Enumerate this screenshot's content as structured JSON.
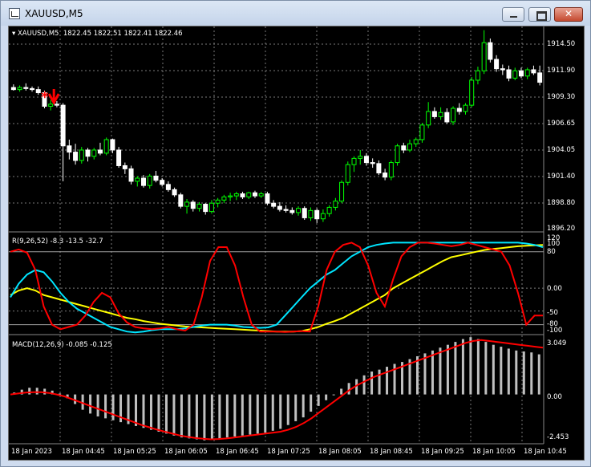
{
  "window": {
    "title": "XAUUSD,M5"
  },
  "main_pane": {
    "symbol_label": "XAUUSD,M5",
    "ohlc_label": "1822.45 1822.51 1822.41 1822.46",
    "price_ticks": [
      "1914.50",
      "1911.90",
      "1909.30",
      "1906.65",
      "1904.05",
      "1901.40",
      "1898.80",
      "1896.20"
    ]
  },
  "rsi_pane": {
    "label": "R(9,26,52) -8.3 -13.5 -32.7",
    "ticks": [
      "120",
      "100",
      "80",
      "0.00",
      "-50",
      "-80",
      "-100"
    ]
  },
  "macd_pane": {
    "label": "MACD(12,26,9) -0.085 -0.125",
    "ticks": [
      "3.049",
      "0.00",
      "-2.453"
    ]
  },
  "time_axis": [
    "18 Jan 2023",
    "18 Jan 04:45",
    "18 Jan 05:25",
    "18 Jan 06:05",
    "18 Jan 06:45",
    "18 Jan 07:25",
    "18 Jan 08:05",
    "18 Jan 08:45",
    "18 Jan 09:25",
    "18 Jan 10:05",
    "18 Jan 10:45"
  ],
  "colors": {
    "bull": "#00ff00",
    "bear": "#ffffff",
    "rsi_fast": "#ff0000",
    "rsi_mid": "#00e5ff",
    "rsi_slow": "#ffff00",
    "macd_hist": "#c0c0c0",
    "macd_signal": "#ff0000",
    "arrow": "#ff0000"
  },
  "chart_data": {
    "type": "candlestick",
    "price_range": [
      1896.2,
      1915.6
    ],
    "grid": true,
    "candles": [
      {
        "o": 1909.9,
        "h": 1910.2,
        "l": 1909.6,
        "c": 1909.7
      },
      {
        "o": 1909.7,
        "h": 1910.1,
        "l": 1909.5,
        "c": 1909.9
      },
      {
        "o": 1909.9,
        "h": 1910.3,
        "l": 1909.6,
        "c": 1909.8
      },
      {
        "o": 1909.8,
        "h": 1910.0,
        "l": 1909.5,
        "c": 1909.7
      },
      {
        "o": 1909.7,
        "h": 1910.0,
        "l": 1909.2,
        "c": 1909.4
      },
      {
        "o": 1909.4,
        "h": 1909.6,
        "l": 1907.9,
        "c": 1908.1
      },
      {
        "o": 1908.1,
        "h": 1908.7,
        "l": 1907.7,
        "c": 1908.3
      },
      {
        "o": 1908.3,
        "h": 1908.6,
        "l": 1908.0,
        "c": 1908.2
      },
      {
        "o": 1908.2,
        "h": 1908.4,
        "l": 1900.9,
        "c": 1904.3
      },
      {
        "o": 1904.3,
        "h": 1904.9,
        "l": 1903.0,
        "c": 1903.7
      },
      {
        "o": 1903.7,
        "h": 1904.5,
        "l": 1902.5,
        "c": 1902.9
      },
      {
        "o": 1902.9,
        "h": 1904.2,
        "l": 1902.6,
        "c": 1903.9
      },
      {
        "o": 1903.9,
        "h": 1904.1,
        "l": 1902.8,
        "c": 1903.3
      },
      {
        "o": 1903.3,
        "h": 1904.1,
        "l": 1903.0,
        "c": 1903.9
      },
      {
        "o": 1903.9,
        "h": 1904.6,
        "l": 1903.4,
        "c": 1903.6
      },
      {
        "o": 1903.6,
        "h": 1905.1,
        "l": 1903.4,
        "c": 1904.9
      },
      {
        "o": 1904.9,
        "h": 1905.0,
        "l": 1903.6,
        "c": 1903.9
      },
      {
        "o": 1903.9,
        "h": 1904.2,
        "l": 1902.2,
        "c": 1902.4
      },
      {
        "o": 1902.4,
        "h": 1902.7,
        "l": 1901.6,
        "c": 1902.1
      },
      {
        "o": 1902.1,
        "h": 1902.4,
        "l": 1900.6,
        "c": 1900.9
      },
      {
        "o": 1900.9,
        "h": 1901.4,
        "l": 1900.4,
        "c": 1901.2
      },
      {
        "o": 1901.2,
        "h": 1901.5,
        "l": 1900.3,
        "c": 1900.5
      },
      {
        "o": 1900.5,
        "h": 1901.6,
        "l": 1900.2,
        "c": 1901.4
      },
      {
        "o": 1901.4,
        "h": 1901.9,
        "l": 1900.8,
        "c": 1901.0
      },
      {
        "o": 1901.0,
        "h": 1901.2,
        "l": 1900.4,
        "c": 1900.6
      },
      {
        "o": 1900.6,
        "h": 1900.9,
        "l": 1899.9,
        "c": 1900.1
      },
      {
        "o": 1900.1,
        "h": 1900.3,
        "l": 1899.4,
        "c": 1899.6
      },
      {
        "o": 1899.6,
        "h": 1899.8,
        "l": 1898.3,
        "c": 1898.5
      },
      {
        "o": 1898.5,
        "h": 1899.2,
        "l": 1897.8,
        "c": 1898.9
      },
      {
        "o": 1898.9,
        "h": 1899.1,
        "l": 1898.0,
        "c": 1898.3
      },
      {
        "o": 1898.3,
        "h": 1898.9,
        "l": 1898.0,
        "c": 1898.7
      },
      {
        "o": 1898.7,
        "h": 1898.8,
        "l": 1897.7,
        "c": 1898.0
      },
      {
        "o": 1898.0,
        "h": 1899.1,
        "l": 1897.8,
        "c": 1898.8
      },
      {
        "o": 1898.8,
        "h": 1899.3,
        "l": 1898.4,
        "c": 1899.1
      },
      {
        "o": 1899.1,
        "h": 1899.6,
        "l": 1898.8,
        "c": 1899.4
      },
      {
        "o": 1899.4,
        "h": 1899.8,
        "l": 1899.0,
        "c": 1899.5
      },
      {
        "o": 1899.5,
        "h": 1899.9,
        "l": 1899.1,
        "c": 1899.7
      },
      {
        "o": 1899.7,
        "h": 1899.9,
        "l": 1899.2,
        "c": 1899.4
      },
      {
        "o": 1899.4,
        "h": 1899.9,
        "l": 1899.2,
        "c": 1899.8
      },
      {
        "o": 1899.8,
        "h": 1900.0,
        "l": 1899.3,
        "c": 1899.5
      },
      {
        "o": 1899.5,
        "h": 1899.9,
        "l": 1899.3,
        "c": 1899.7
      },
      {
        "o": 1899.7,
        "h": 1899.9,
        "l": 1898.6,
        "c": 1898.8
      },
      {
        "o": 1898.8,
        "h": 1899.1,
        "l": 1898.3,
        "c": 1898.5
      },
      {
        "o": 1898.5,
        "h": 1898.9,
        "l": 1898.0,
        "c": 1898.2
      },
      {
        "o": 1898.2,
        "h": 1898.6,
        "l": 1897.9,
        "c": 1898.1
      },
      {
        "o": 1898.1,
        "h": 1898.4,
        "l": 1897.7,
        "c": 1897.9
      },
      {
        "o": 1897.9,
        "h": 1898.5,
        "l": 1897.6,
        "c": 1898.3
      },
      {
        "o": 1898.3,
        "h": 1898.5,
        "l": 1897.2,
        "c": 1897.4
      },
      {
        "o": 1897.4,
        "h": 1898.4,
        "l": 1897.1,
        "c": 1898.1
      },
      {
        "o": 1898.1,
        "h": 1898.3,
        "l": 1896.9,
        "c": 1897.3
      },
      {
        "o": 1897.3,
        "h": 1898.2,
        "l": 1897.0,
        "c": 1897.8
      },
      {
        "o": 1897.8,
        "h": 1898.6,
        "l": 1897.5,
        "c": 1898.4
      },
      {
        "o": 1898.4,
        "h": 1899.3,
        "l": 1898.1,
        "c": 1899.0
      },
      {
        "o": 1899.0,
        "h": 1901.0,
        "l": 1898.8,
        "c": 1900.8
      },
      {
        "o": 1900.8,
        "h": 1902.8,
        "l": 1900.5,
        "c": 1902.5
      },
      {
        "o": 1902.5,
        "h": 1903.3,
        "l": 1901.8,
        "c": 1903.1
      },
      {
        "o": 1903.1,
        "h": 1903.9,
        "l": 1902.5,
        "c": 1903.3
      },
      {
        "o": 1903.3,
        "h": 1903.6,
        "l": 1902.4,
        "c": 1902.7
      },
      {
        "o": 1902.7,
        "h": 1903.1,
        "l": 1902.2,
        "c": 1902.6
      },
      {
        "o": 1902.6,
        "h": 1902.9,
        "l": 1901.5,
        "c": 1901.7
      },
      {
        "o": 1901.7,
        "h": 1902.1,
        "l": 1901.0,
        "c": 1901.3
      },
      {
        "o": 1901.3,
        "h": 1902.9,
        "l": 1901.0,
        "c": 1902.7
      },
      {
        "o": 1902.7,
        "h": 1904.5,
        "l": 1902.4,
        "c": 1904.3
      },
      {
        "o": 1904.3,
        "h": 1904.6,
        "l": 1903.6,
        "c": 1903.9
      },
      {
        "o": 1903.9,
        "h": 1904.9,
        "l": 1903.7,
        "c": 1904.5
      },
      {
        "o": 1904.5,
        "h": 1905.1,
        "l": 1904.2,
        "c": 1904.9
      },
      {
        "o": 1904.9,
        "h": 1906.5,
        "l": 1904.6,
        "c": 1906.3
      },
      {
        "o": 1906.3,
        "h": 1908.5,
        "l": 1906.0,
        "c": 1907.6
      },
      {
        "o": 1907.6,
        "h": 1908.0,
        "l": 1906.9,
        "c": 1907.1
      },
      {
        "o": 1907.1,
        "h": 1908.0,
        "l": 1906.8,
        "c": 1907.5
      },
      {
        "o": 1907.5,
        "h": 1907.9,
        "l": 1906.4,
        "c": 1906.6
      },
      {
        "o": 1906.6,
        "h": 1908.1,
        "l": 1906.3,
        "c": 1907.9
      },
      {
        "o": 1907.9,
        "h": 1908.4,
        "l": 1907.3,
        "c": 1907.6
      },
      {
        "o": 1907.6,
        "h": 1908.4,
        "l": 1907.3,
        "c": 1908.2
      },
      {
        "o": 1908.2,
        "h": 1910.9,
        "l": 1908.0,
        "c": 1910.6
      },
      {
        "o": 1910.6,
        "h": 1911.9,
        "l": 1910.2,
        "c": 1911.5
      },
      {
        "o": 1911.5,
        "h": 1915.4,
        "l": 1911.2,
        "c": 1914.2
      },
      {
        "o": 1914.2,
        "h": 1914.6,
        "l": 1912.3,
        "c": 1912.6
      },
      {
        "o": 1912.6,
        "h": 1913.0,
        "l": 1911.4,
        "c": 1911.7
      },
      {
        "o": 1911.7,
        "h": 1912.1,
        "l": 1911.1,
        "c": 1911.6
      },
      {
        "o": 1911.6,
        "h": 1912.0,
        "l": 1910.5,
        "c": 1910.8
      },
      {
        "o": 1910.8,
        "h": 1911.8,
        "l": 1910.6,
        "c": 1911.5
      },
      {
        "o": 1911.5,
        "h": 1911.8,
        "l": 1910.8,
        "c": 1911.0
      },
      {
        "o": 1911.0,
        "h": 1911.8,
        "l": 1910.7,
        "c": 1911.6
      },
      {
        "o": 1911.6,
        "h": 1912.0,
        "l": 1911.1,
        "c": 1911.3
      },
      {
        "o": 1911.3,
        "h": 1912.0,
        "l": 1910.1,
        "c": 1910.4
      }
    ],
    "rsi_range": [
      -100,
      120
    ],
    "rsi_fast": [
      80,
      85,
      78,
      40,
      -40,
      -80,
      -90,
      -85,
      -80,
      -60,
      -30,
      -10,
      -20,
      -55,
      -75,
      -85,
      -88,
      -90,
      -88,
      -85,
      -90,
      -93,
      -80,
      -20,
      60,
      90,
      90,
      50,
      -20,
      -80,
      -95,
      -95,
      -95,
      -96,
      -95,
      -94,
      -95,
      -40,
      40,
      80,
      95,
      100,
      90,
      50,
      -10,
      -40,
      20,
      70,
      90,
      100,
      100,
      98,
      95,
      92,
      95,
      100,
      95,
      90,
      85,
      80,
      50,
      -10,
      -80,
      -60,
      -60
    ],
    "rsi_mid": [
      -20,
      10,
      30,
      40,
      35,
      15,
      -10,
      -30,
      -45,
      -55,
      -65,
      -75,
      -85,
      -90,
      -95,
      -97,
      -95,
      -92,
      -90,
      -90,
      -90,
      -88,
      -85,
      -82,
      -80,
      -80,
      -80,
      -82,
      -85,
      -86,
      -87,
      -86,
      -80,
      -60,
      -40,
      -20,
      0,
      15,
      30,
      40,
      55,
      70,
      80,
      90,
      95,
      98,
      100,
      100,
      100,
      100,
      100,
      100,
      100,
      100,
      100,
      100,
      100,
      100,
      100,
      100,
      100,
      100,
      98,
      95,
      90
    ],
    "rsi_slow": [
      -15,
      -5,
      0,
      -5,
      -15,
      -20,
      -25,
      -30,
      -35,
      -40,
      -45,
      -50,
      -55,
      -60,
      -65,
      -68,
      -72,
      -75,
      -78,
      -80,
      -82,
      -84,
      -85,
      -86,
      -87,
      -88,
      -89,
      -90,
      -91,
      -92,
      -93,
      -94,
      -95,
      -95,
      -95,
      -94,
      -90,
      -85,
      -78,
      -72,
      -65,
      -55,
      -45,
      -35,
      -25,
      -15,
      0,
      10,
      20,
      30,
      40,
      50,
      60,
      68,
      72,
      76,
      80,
      84,
      86,
      88,
      90,
      92,
      93,
      94,
      95
    ],
    "macd_range": [
      -2.453,
      3.049
    ],
    "macd_hist": [
      0.1,
      0.25,
      0.35,
      0.35,
      0.3,
      0.2,
      0.05,
      -0.2,
      -0.5,
      -0.8,
      -1.0,
      -1.15,
      -1.25,
      -1.35,
      -1.45,
      -1.55,
      -1.65,
      -1.75,
      -1.85,
      -1.95,
      -2.05,
      -2.15,
      -2.25,
      -2.3,
      -2.35,
      -2.4,
      -2.35,
      -2.3,
      -2.25,
      -2.2,
      -2.15,
      -2.1,
      -2.05,
      -2.0,
      -1.9,
      -1.8,
      -1.6,
      -1.4,
      -1.2,
      -0.9,
      -0.6,
      -0.3,
      0.0,
      0.3,
      0.6,
      0.8,
      1.0,
      1.2,
      1.3,
      1.45,
      1.6,
      1.7,
      1.85,
      2.0,
      2.15,
      2.3,
      2.45,
      2.6,
      2.75,
      2.9,
      3.0,
      2.9,
      2.75,
      2.6,
      2.5,
      2.4,
      2.3,
      2.25,
      2.2,
      2.1
    ],
    "macd_signal": [
      0.0,
      0.05,
      0.1,
      0.12,
      0.12,
      0.08,
      0.0,
      -0.1,
      -0.25,
      -0.4,
      -0.55,
      -0.7,
      -0.85,
      -1.0,
      -1.15,
      -1.3,
      -1.45,
      -1.6,
      -1.72,
      -1.84,
      -1.95,
      -2.05,
      -2.15,
      -2.22,
      -2.28,
      -2.32,
      -2.35,
      -2.33,
      -2.3,
      -2.25,
      -2.2,
      -2.15,
      -2.1,
      -2.05,
      -2.0,
      -1.95,
      -1.85,
      -1.7,
      -1.5,
      -1.25,
      -0.95,
      -0.65,
      -0.35,
      -0.05,
      0.25,
      0.5,
      0.7,
      0.9,
      1.05,
      1.2,
      1.35,
      1.5,
      1.65,
      1.8,
      1.95,
      2.1,
      2.25,
      2.4,
      2.55,
      2.7,
      2.8,
      2.85,
      2.8,
      2.75,
      2.7,
      2.65,
      2.6,
      2.55,
      2.5,
      2.45
    ]
  }
}
